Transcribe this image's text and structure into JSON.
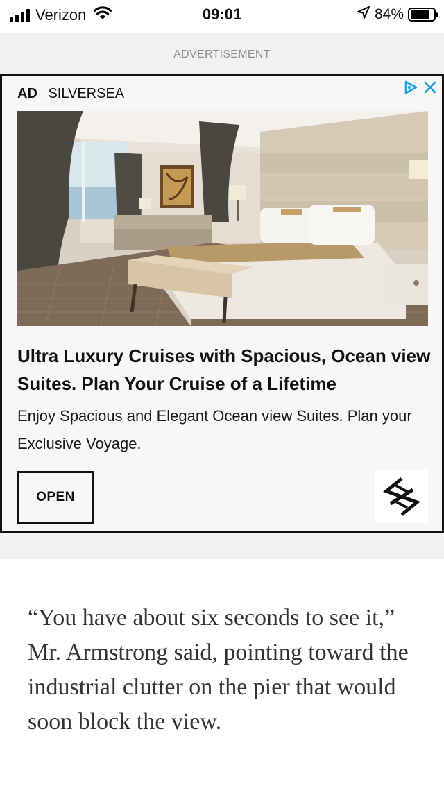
{
  "status_bar": {
    "carrier": "Verizon",
    "time": "09:01",
    "battery_percent": "84%",
    "battery_level": 0.84
  },
  "ad": {
    "label": "ADVERTISEMENT",
    "tag": "AD",
    "advertiser": "SILVERSEA",
    "headline": "Ultra Luxury Cruises with Spacious, Ocean view Suites. Plan Your Cruise of a Lifetime",
    "description": "Enjoy Spacious and Elegant Ocean view Suites. Plan your Exclusive Voyage.",
    "cta_label": "OPEN",
    "adchoices_color": "#1a9fe0"
  },
  "article": {
    "paragraph": "“You have about six seconds to see it,” Mr. Armstrong said, pointing toward the industrial clutter on the pier that would soon block the view."
  }
}
